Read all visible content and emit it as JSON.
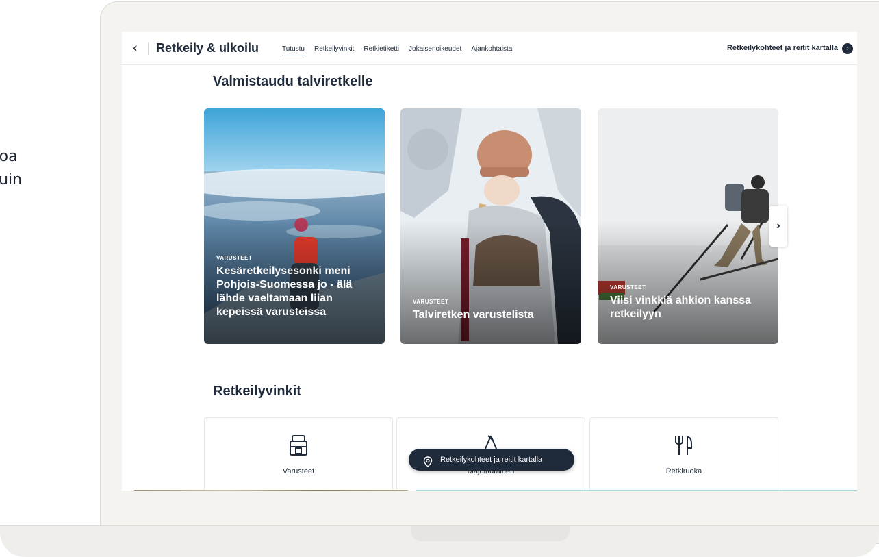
{
  "side_text": {
    "line1": "toa",
    "line2": "kuin"
  },
  "nav": {
    "title": "Retkeily & ulkoilu",
    "tabs": [
      {
        "label": "Tutustu",
        "active": true
      },
      {
        "label": "Retkeilyvinkit",
        "active": false
      },
      {
        "label": "Retkietiketti",
        "active": false
      },
      {
        "label": "Jokaisenoikeudet",
        "active": false
      },
      {
        "label": "Ajankohtaista",
        "active": false
      }
    ],
    "map_link": "Retkeilykohteet ja reitit kartalla"
  },
  "sections": {
    "winter_title": "Valmistaudu talviretkelle",
    "tips_title": "Retkeilyvinkit"
  },
  "cards": [
    {
      "category": "VARUSTEET",
      "title": "Kesäretkeilysesonki meni Pohjois-Suomessa jo - älä lähde vaeltamaan liian kepeissä varusteissa"
    },
    {
      "category": "VARUSTEET",
      "title": "Talviretken varustelista"
    },
    {
      "category": "VARUSTEET",
      "title": "Viisi vinkkiä ahkion kanssa retkeilyyn"
    }
  ],
  "tips": [
    {
      "label": "Varusteet",
      "icon": "backpack-icon"
    },
    {
      "label": "Majoittuminen",
      "icon": "tent-icon"
    },
    {
      "label": "Retkiruoka",
      "icon": "fork-spoon-icon"
    }
  ],
  "floating_button": {
    "label": "Retkeilykohteet ja reitit kartalla",
    "icon": "map-pin-icon"
  },
  "colors": {
    "primary_dark": "#1f2a3a",
    "background": "#ffffff",
    "laptop": "#f4f3f0"
  }
}
